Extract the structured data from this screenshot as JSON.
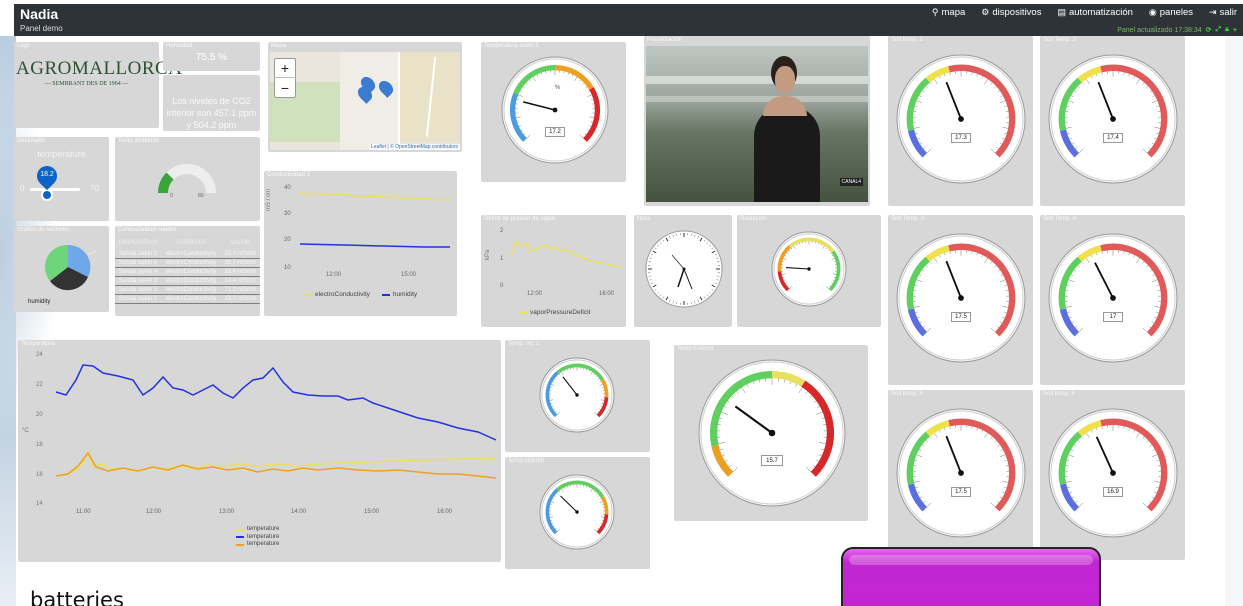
{
  "header": {
    "title": "Nadia",
    "subtitle": "Panel demo",
    "nav": [
      {
        "icon": "map-marker-icon",
        "label": "mapa"
      },
      {
        "icon": "devices-icon",
        "label": "dispositivos"
      },
      {
        "icon": "automation-icon",
        "label": "automatización"
      },
      {
        "icon": "dashboard-icon",
        "label": "paneles"
      },
      {
        "icon": "logout-icon",
        "label": "salir"
      }
    ],
    "updated": "Panel actualizado 17:38:34"
  },
  "panels": {
    "logo": {
      "title": "Logo",
      "brand": "AGROMALLORCA",
      "tagline": "— SEMBRANT DES DE 1964 —"
    },
    "humedad": {
      "title": "Humedad",
      "value": "75.5 %"
    },
    "co2": {
      "text": "Los niveles de CO2 interior son 457.1 ppm y 504.2 ppm"
    },
    "mapa": {
      "title": "Mapa",
      "zoom_in": "+",
      "zoom_out": "−",
      "attribution": "Leaflet | © OpenStreetMap contributors"
    },
    "temp_suelo_1": {
      "title": "Temperatura suelo 1",
      "value": "17.2",
      "unit": "%"
    },
    "presentacion": {
      "title": "Presentación",
      "badge": "CANAL4"
    },
    "soil1": {
      "title": "Soil temp. 1",
      "value": "17.3"
    },
    "soil2": {
      "title": "Soil Temp. 2",
      "value": "17.4"
    },
    "soil3": {
      "title": "Soil Temp. 3",
      "value": "17.5"
    },
    "soil4": {
      "title": "Soil Temp. 4",
      "value": "17"
    },
    "soil5": {
      "title": "Soil temp. 5",
      "value": "17.5"
    },
    "soil6": {
      "title": "Soil temp. 6",
      "value": "16.9"
    },
    "deslizador": {
      "title": "Deslizador",
      "label": "temperature",
      "value": "18.2",
      "min": "0",
      "max": "70"
    },
    "temp_ambiente": {
      "title": "Temp ambiente",
      "min": "0",
      "max": "80"
    },
    "conductividad": {
      "title": "Conductividad 1",
      "ylabel": "mS / cm",
      "yticks": [
        "40",
        "30",
        "20",
        "10"
      ],
      "xticks": [
        "12:00",
        "15:00"
      ],
      "legend": [
        "electroConductivity",
        "humidity"
      ]
    },
    "deficit": {
      "title": "Déficit de presión de vapor",
      "ylabel": "kPa",
      "yticks": [
        "2",
        "1",
        "0"
      ],
      "xticks": [
        "12:00",
        "16:00"
      ],
      "legend": [
        "vaporPressureDeficit"
      ]
    },
    "hora": {
      "title": "Hora"
    },
    "radiacion": {
      "title": "Radiación"
    },
    "sectores": {
      "title": "Gráfico de sectores",
      "label": "humidity"
    },
    "cond_cuadro": {
      "title": "Conductividad cuadro",
      "headers": [
        "DISPOSITIVO",
        "ATRIBUTO",
        "VALOR"
      ],
      "rows": [
        [
          "Sonda suelo 2",
          "electroConductivity",
          "35.3 mS/cm"
        ],
        [
          "Sonda suelo 6",
          "electroConductivity",
          "28.7 mS/cm"
        ],
        [
          "Sonda suelo 4",
          "electroConductivity",
          "33.6 mS/cm"
        ],
        [
          "Sonda suelo 3",
          "electroConductivity",
          "14.4 mS/cm"
        ],
        [
          "Sonda suelo 5",
          "electroConductivity",
          "71.3 mS/cm"
        ],
        [
          "Sonda suelo 1",
          "electroConductivity",
          "19.3 mS/cm"
        ]
      ]
    },
    "temperatura": {
      "title": "Temperatura",
      "ylabel": "°C",
      "yticks": [
        "24",
        "22",
        "20",
        "18",
        "16",
        "14"
      ],
      "xticks": [
        "11:00",
        "12:00",
        "13:00",
        "14:00",
        "15:00",
        "16:00"
      ],
      "legend": [
        "temperature",
        "temperature",
        "temperature"
      ]
    },
    "temp_int": {
      "title": "Temp. Int. 1"
    },
    "temp_ext_small": {
      "title": "Temp exterior"
    },
    "temp_exterior": {
      "title": "Temp Exterior",
      "value": "15.7"
    }
  },
  "overlay_text": "batteries",
  "colors": {
    "topbar": "#2e3338",
    "panel": "#d7d7d7",
    "blue": "#2233dd",
    "yellow": "#e8e060",
    "orange": "#f0a020"
  }
}
